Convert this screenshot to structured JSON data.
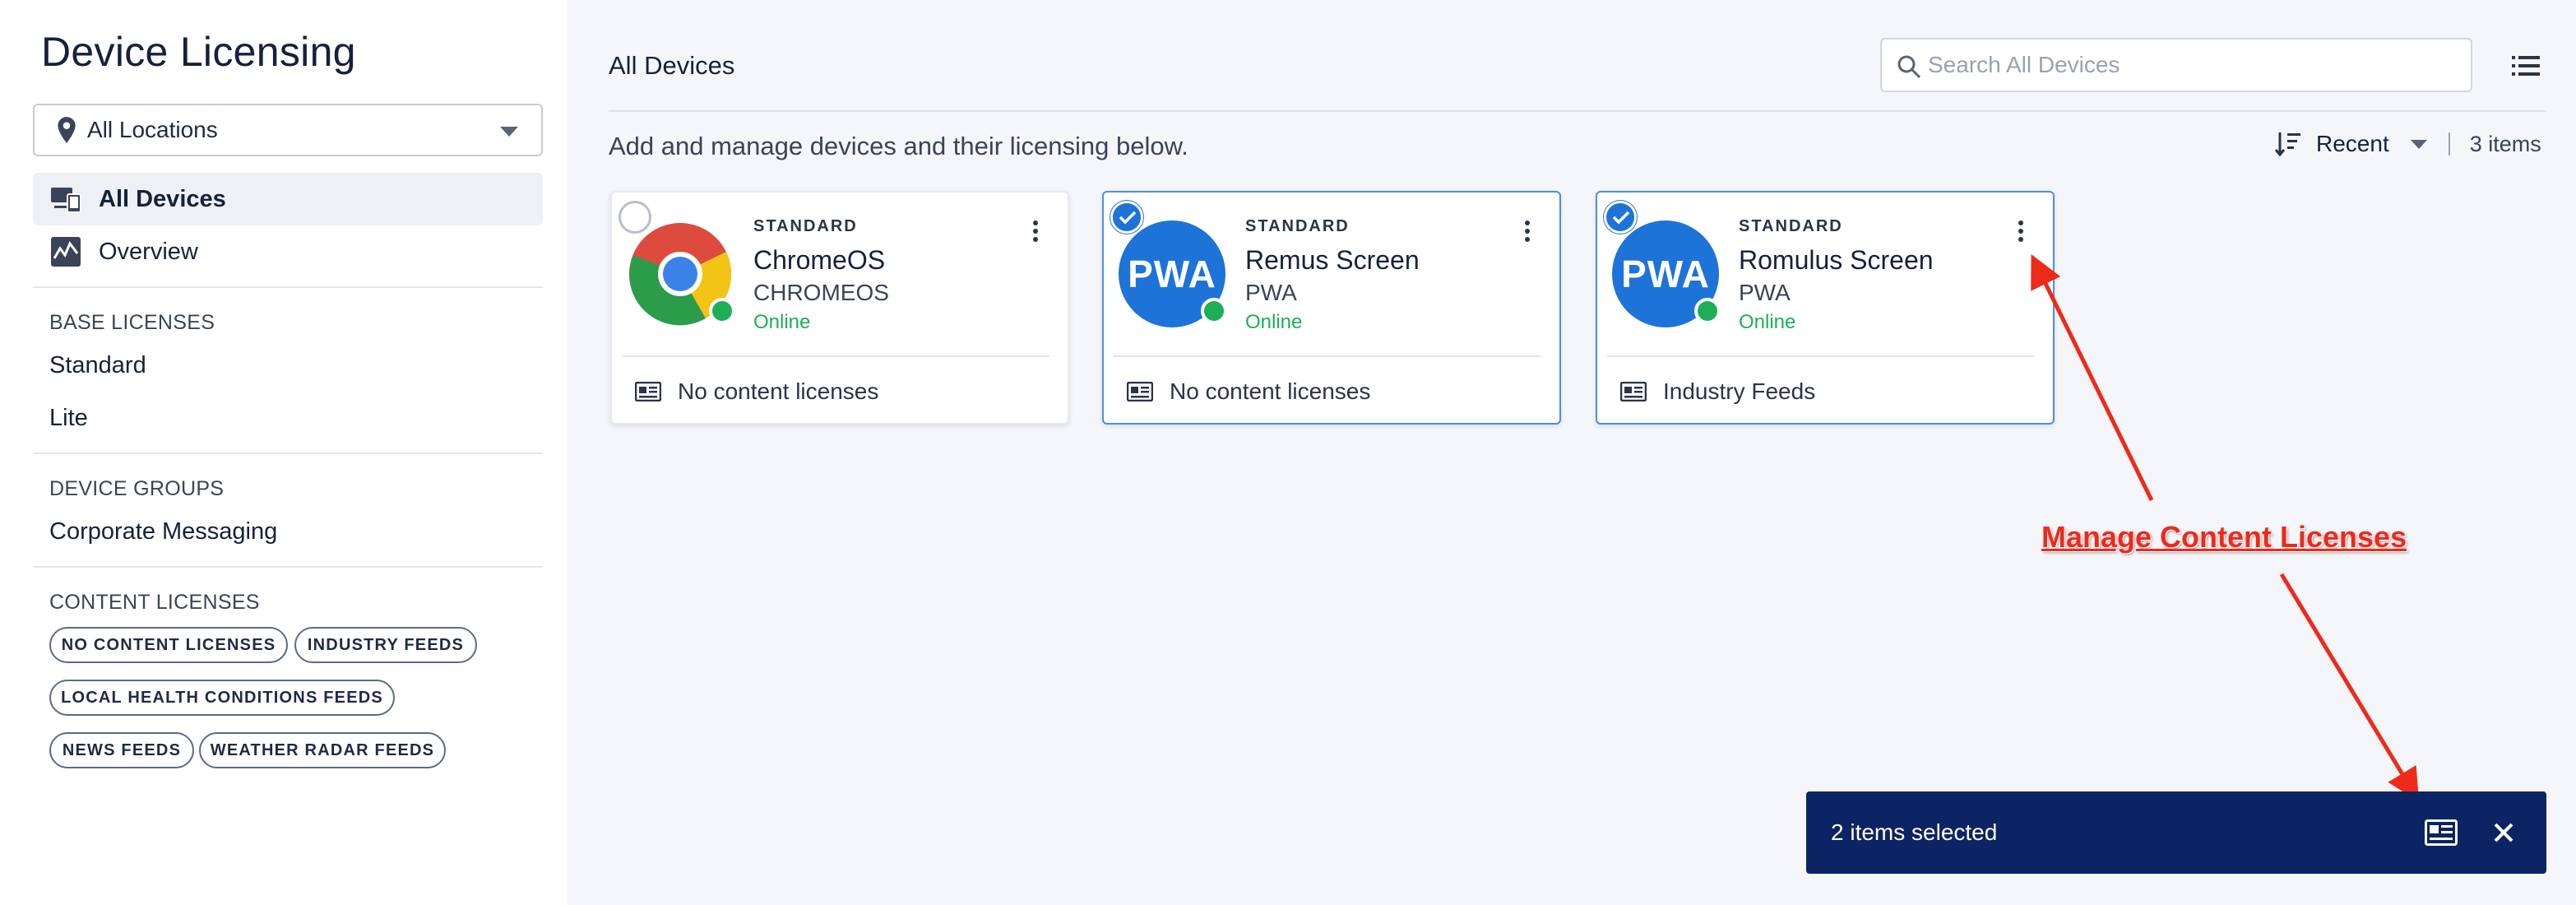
{
  "sidebar": {
    "title": "Device Licensing",
    "location": {
      "value": "All Locations",
      "icon": "map-pin-icon"
    },
    "nav": [
      {
        "label": "All Devices",
        "icon": "devices-icon",
        "active": true
      },
      {
        "label": "Overview",
        "icon": "activity-chart-icon",
        "active": false
      }
    ],
    "base_licenses": {
      "heading": "BASE LICENSES",
      "items": [
        "Standard",
        "Lite"
      ]
    },
    "device_groups": {
      "heading": "DEVICE GROUPS",
      "items": [
        "Corporate Messaging"
      ]
    },
    "content_licenses": {
      "heading": "CONTENT LICENSES",
      "chips": [
        "NO CONTENT LICENSES",
        "INDUSTRY FEEDS",
        "LOCAL HEALTH CONDITIONS FEEDS",
        "NEWS FEEDS",
        "WEATHER RADAR FEEDS"
      ]
    }
  },
  "main": {
    "title": "All Devices",
    "search": {
      "placeholder": "Search All Devices",
      "value": ""
    },
    "subtitle": "Add and manage devices and their licensing below.",
    "sort": {
      "label": "Recent"
    },
    "count": "3 items",
    "devices": [
      {
        "tier": "STANDARD",
        "name": "ChromeOS",
        "kind": "CHROMEOS",
        "status": "Online",
        "logo": "chrome-logo-icon",
        "selected": false,
        "licenses": "No content licenses"
      },
      {
        "tier": "STANDARD",
        "name": "Remus Screen",
        "kind": "PWA",
        "status": "Online",
        "logo_text": "PWA",
        "selected": true,
        "licenses": "No content licenses"
      },
      {
        "tier": "STANDARD",
        "name": "Romulus Screen",
        "kind": "PWA",
        "status": "Online",
        "logo_text": "PWA",
        "selected": true,
        "licenses": "Industry Feeds"
      }
    ]
  },
  "annotation": {
    "text": "Manage Content Licenses",
    "color": "#ee2a1b"
  },
  "selection_bar": {
    "text": "2 items selected",
    "background": "#0c2463"
  },
  "colors": {
    "accent": "#1e73d8",
    "online": "#1fae58"
  }
}
